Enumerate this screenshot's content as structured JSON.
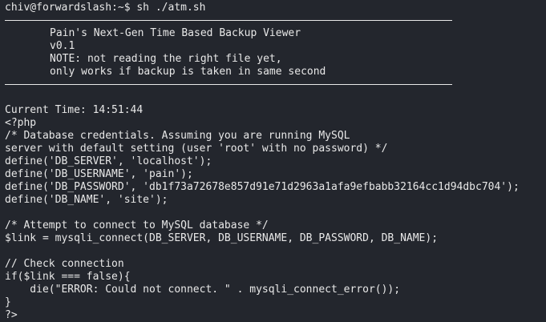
{
  "terminal": {
    "prompt_line": "chiv@forwardslash:~$ sh ./atm.sh",
    "banner": {
      "title": "Pain's Next-Gen Time Based Backup Viewer",
      "version": "v0.1",
      "note1": "NOTE: not reading the right file yet,",
      "note2": "only works if backup is taken in same second"
    },
    "current_time": "Current Time: 14:51:44",
    "code": [
      "<?php",
      "/* Database credentials. Assuming you are running MySQL",
      "server with default setting (user 'root' with no password) */",
      "define('DB_SERVER', 'localhost');",
      "define('DB_USERNAME', 'pain');",
      "define('DB_PASSWORD', 'db1f73a72678e857d91e71d2963a1afa9efbabb32164cc1d94dbc704');",
      "define('DB_NAME', 'site');",
      "",
      "/* Attempt to connect to MySQL database */",
      "$link = mysqli_connect(DB_SERVER, DB_USERNAME, DB_PASSWORD, DB_NAME);",
      "",
      "// Check connection",
      "if($link === false){",
      "    die(\"ERROR: Could not connect. \" . mysqli_connect_error());",
      "}",
      "?>"
    ]
  }
}
